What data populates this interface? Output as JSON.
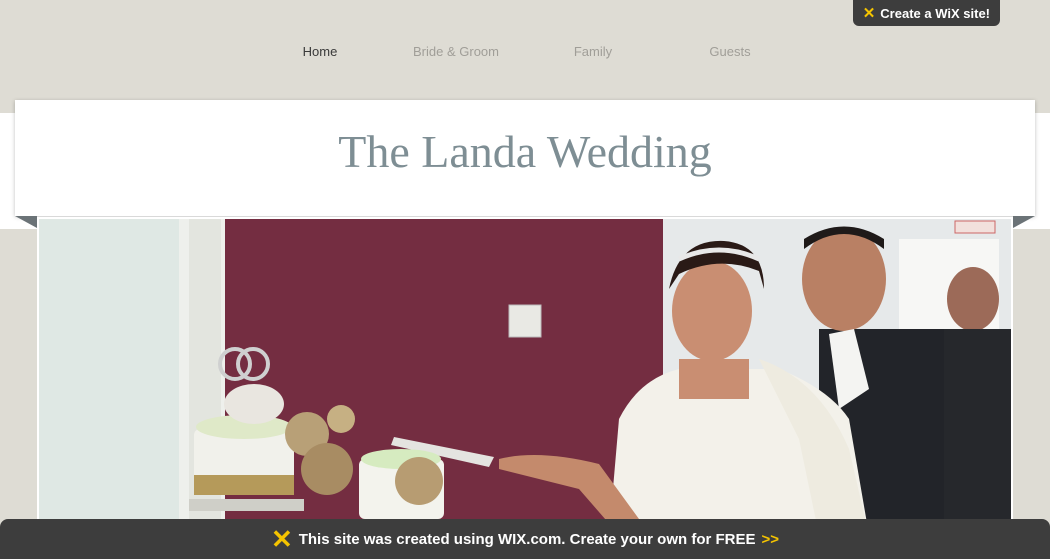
{
  "wix_badge": {
    "icon": "wix-x-icon",
    "label": "Create a WiX site!"
  },
  "nav": {
    "items": [
      {
        "label": "Home",
        "active": true
      },
      {
        "label": "Bride & Groom",
        "active": false
      },
      {
        "label": "Family",
        "active": false
      },
      {
        "label": "Guests",
        "active": false
      }
    ]
  },
  "header": {
    "title": "The Landa Wedding"
  },
  "photo": {
    "description_icon": "wedding-photo"
  },
  "footer_bar": {
    "icon": "wix-x-icon",
    "text": "This site was created using WIX.com. Create your own for FREE",
    "arrows": ">>"
  },
  "colors": {
    "background": "#dedcd4",
    "title": "#7e8e94",
    "bar": "#3d3d3d",
    "accent": "#f5c400"
  }
}
